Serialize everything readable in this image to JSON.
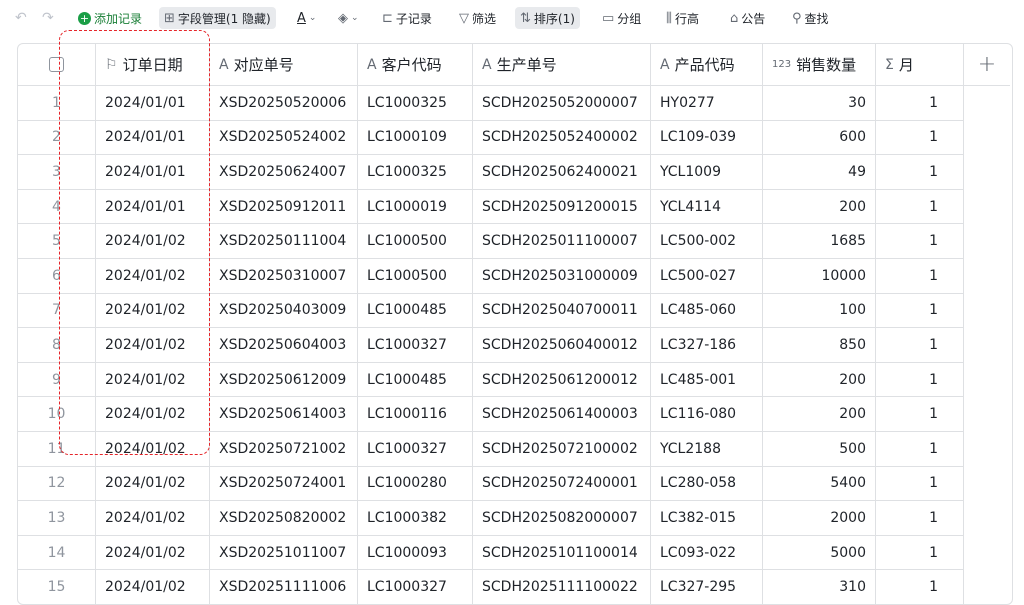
{
  "toolbar": {
    "undo_icon": "undo-icon",
    "redo_icon": "redo-icon",
    "add_record": "添加记录",
    "field_manage": "字段管理(1 隐藏)",
    "sub_record": "子记录",
    "filter": "筛选",
    "sort": "排序(1)",
    "group": "分组",
    "row_height": "行高",
    "notice": "公告",
    "search": "查找"
  },
  "columns": [
    {
      "icon": "flag-icon",
      "glyph": "⚐",
      "label": "订单日期"
    },
    {
      "icon": "text-type-icon",
      "glyph": "A",
      "label": "对应单号"
    },
    {
      "icon": "text-type-icon",
      "glyph": "A",
      "label": "客户代码"
    },
    {
      "icon": "text-type-icon",
      "glyph": "A",
      "label": "生产单号"
    },
    {
      "icon": "text-type-icon",
      "glyph": "A",
      "label": "产品代码"
    },
    {
      "icon": "number-type-icon",
      "glyph": "123",
      "label": "销售数量"
    },
    {
      "icon": "formula-type-icon",
      "glyph": "Σ",
      "label": "月"
    }
  ],
  "add_column": "+",
  "rows": [
    {
      "n": "1",
      "date": "2024/01/01",
      "ref": "XSD20250520006",
      "cust": "LC1000325",
      "prod_no": "SCDH2025052000007",
      "code": "HY0277",
      "qty": "30",
      "month": "1"
    },
    {
      "n": "2",
      "date": "2024/01/01",
      "ref": "XSD20250524002",
      "cust": "LC1000109",
      "prod_no": "SCDH2025052400002",
      "code": "LC109-039",
      "qty": "600",
      "month": "1"
    },
    {
      "n": "3",
      "date": "2024/01/01",
      "ref": "XSD20250624007",
      "cust": "LC1000325",
      "prod_no": "SCDH2025062400021",
      "code": "YCL1009",
      "qty": "49",
      "month": "1"
    },
    {
      "n": "4",
      "date": "2024/01/01",
      "ref": "XSD20250912011",
      "cust": "LC1000019",
      "prod_no": "SCDH2025091200015",
      "code": "YCL4114",
      "qty": "200",
      "month": "1"
    },
    {
      "n": "5",
      "date": "2024/01/02",
      "ref": "XSD20250111004",
      "cust": "LC1000500",
      "prod_no": "SCDH2025011100007",
      "code": "LC500-002",
      "qty": "1685",
      "month": "1"
    },
    {
      "n": "6",
      "date": "2024/01/02",
      "ref": "XSD20250310007",
      "cust": "LC1000500",
      "prod_no": "SCDH2025031000009",
      "code": "LC500-027",
      "qty": "10000",
      "month": "1"
    },
    {
      "n": "7",
      "date": "2024/01/02",
      "ref": "XSD20250403009",
      "cust": "LC1000485",
      "prod_no": "SCDH2025040700011",
      "code": "LC485-060",
      "qty": "100",
      "month": "1"
    },
    {
      "n": "8",
      "date": "2024/01/02",
      "ref": "XSD20250604003",
      "cust": "LC1000327",
      "prod_no": "SCDH2025060400012",
      "code": "LC327-186",
      "qty": "850",
      "month": "1"
    },
    {
      "n": "9",
      "date": "2024/01/02",
      "ref": "XSD20250612009",
      "cust": "LC1000485",
      "prod_no": "SCDH2025061200012",
      "code": "LC485-001",
      "qty": "200",
      "month": "1"
    },
    {
      "n": "10",
      "date": "2024/01/02",
      "ref": "XSD20250614003",
      "cust": "LC1000116",
      "prod_no": "SCDH2025061400003",
      "code": "LC116-080",
      "qty": "200",
      "month": "1"
    },
    {
      "n": "11",
      "date": "2024/01/02",
      "ref": "XSD20250721002",
      "cust": "LC1000327",
      "prod_no": "SCDH2025072100002",
      "code": "YCL2188",
      "qty": "500",
      "month": "1"
    },
    {
      "n": "12",
      "date": "2024/01/02",
      "ref": "XSD20250724001",
      "cust": "LC1000280",
      "prod_no": "SCDH2025072400001",
      "code": "LC280-058",
      "qty": "5400",
      "month": "1"
    },
    {
      "n": "13",
      "date": "2024/01/02",
      "ref": "XSD20250820002",
      "cust": "LC1000382",
      "prod_no": "SCDH2025082000007",
      "code": "LC382-015",
      "qty": "2000",
      "month": "1"
    },
    {
      "n": "14",
      "date": "2024/01/02",
      "ref": "XSD20251011007",
      "cust": "LC1000093",
      "prod_no": "SCDH2025101100014",
      "code": "LC093-022",
      "qty": "5000",
      "month": "1"
    },
    {
      "n": "15",
      "date": "2024/01/02",
      "ref": "XSD20251111006",
      "cust": "LC1000327",
      "prod_no": "SCDH2025111100022",
      "code": "LC327-295",
      "qty": "310",
      "month": "1"
    }
  ],
  "colors": {
    "accent_green": "#1a9e46",
    "selection_border": "#e5252a",
    "grid_line": "#dee0e3"
  }
}
